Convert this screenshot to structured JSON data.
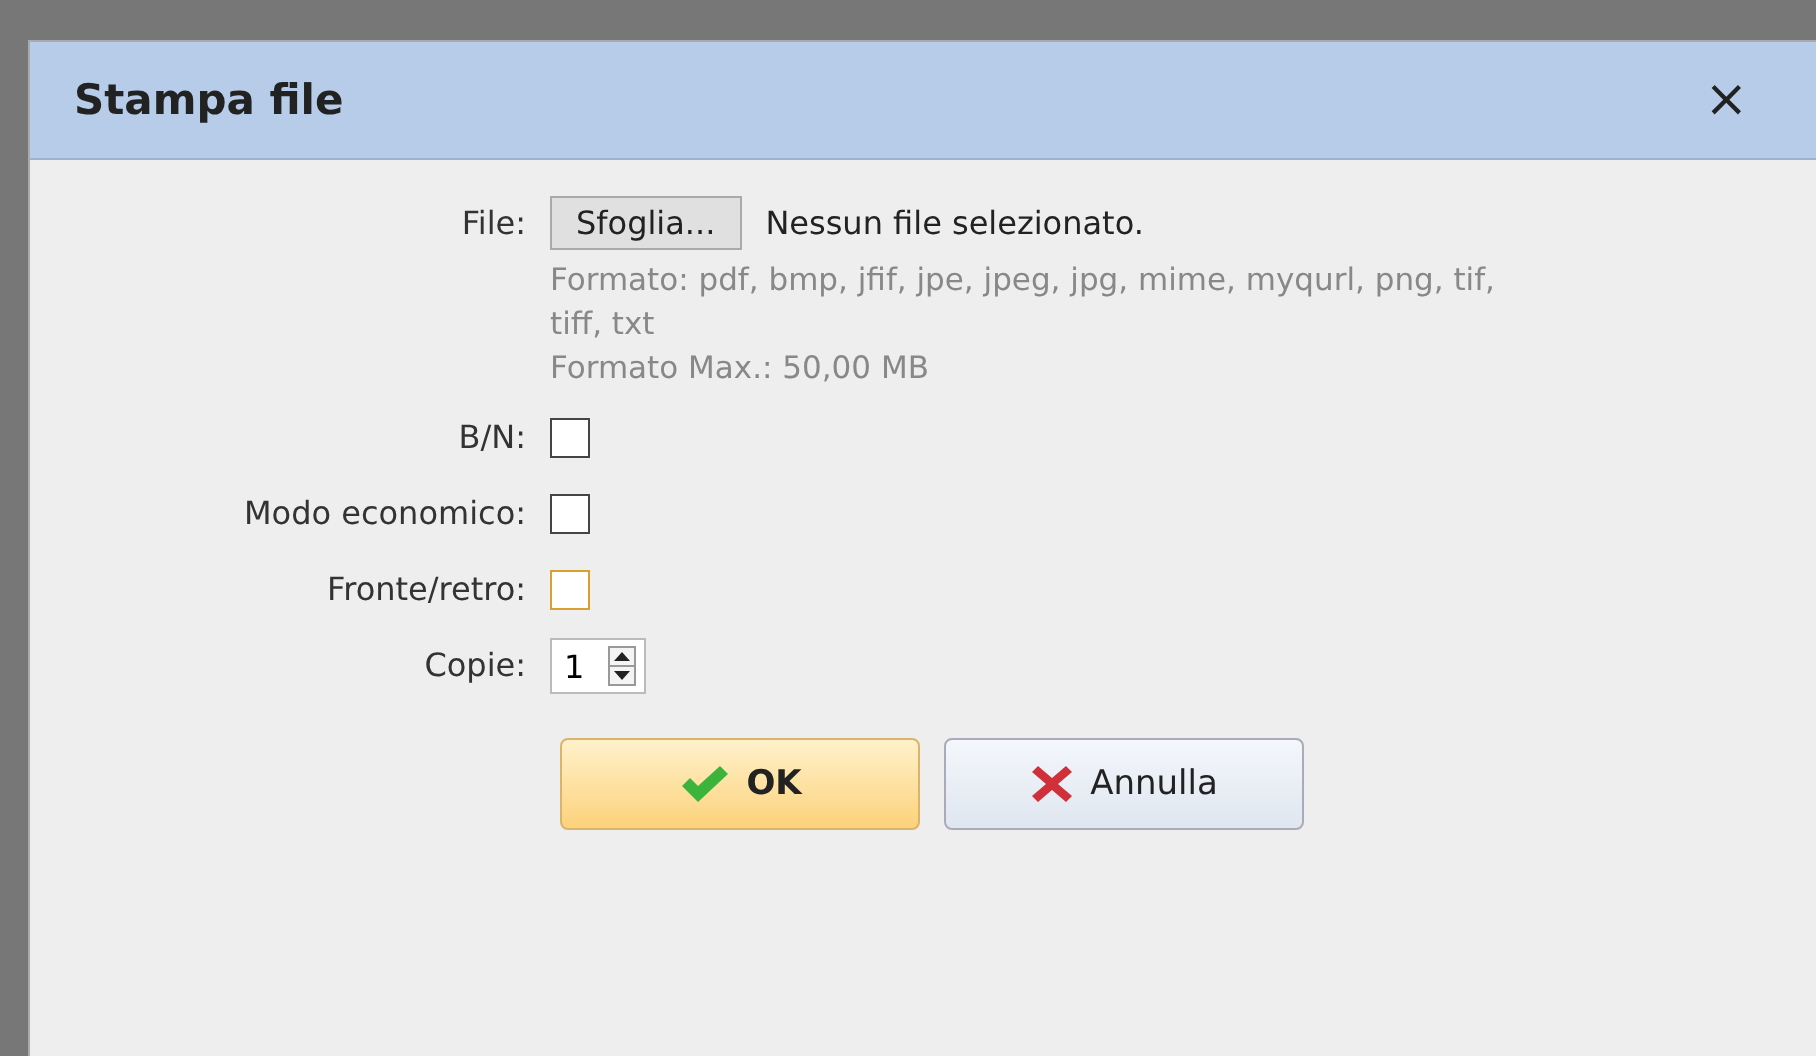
{
  "dialog": {
    "title": "Stampa file",
    "close": "×"
  },
  "fields": [
    {
      "kind": "file",
      "label": "File:",
      "button": "Sfoglia...",
      "value": "Nessun file selezionato.",
      "hints": [
        "Formato: pdf, bmp, jfif, jpe, jpeg, jpg, mime, myqurl, png, tif, tiff, txt",
        "Formato Max.: 50,00 MB"
      ]
    },
    {
      "kind": "checkbox",
      "label": "B/N:",
      "checked": false,
      "focused": false
    },
    {
      "kind": "checkbox",
      "label": "Modo economico:",
      "checked": false,
      "focused": false
    },
    {
      "kind": "checkbox",
      "label": "Fronte/retro:",
      "checked": false,
      "focused": true
    },
    {
      "kind": "number",
      "label": "Copie:",
      "value": "1"
    }
  ],
  "buttons": [
    {
      "kind": "ok",
      "label": "OK"
    },
    {
      "kind": "cancel",
      "label": "Annulla"
    }
  ]
}
